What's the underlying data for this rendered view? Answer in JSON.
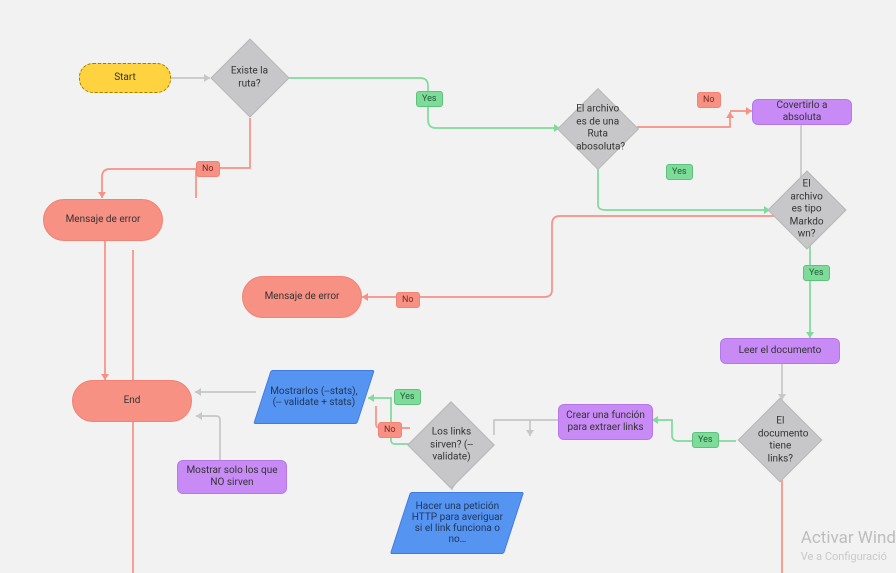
{
  "nodes": {
    "start": "Start",
    "existeRuta": "Existe la ruta?",
    "rutaAbsoluta": "El archivo es de una Ruta abosoluta?",
    "convertir": "Covertirlo a absoluta",
    "tipoMarkdown": "El archivo es tipo Markdo wn?",
    "mensajeError1": "Mensaje de error",
    "mensajeError2": "Mensaje de error",
    "leerDocumento": "Leer el documento",
    "tieneLinks": "El documento tiene links?",
    "crearFuncion": "Crear una función para extraer links",
    "linksSirven": "Los links sirven? (--validate)",
    "hacerPeticion": "Hacer una petición HTTP para averiguar si el link funciona o no…",
    "mostrarlos": "Mostrarlos (--stats),(-- validate + stats)",
    "mostrarSoloNo": "Mostrar solo los que NO sirven",
    "end": "End"
  },
  "tags": {
    "yes": "Yes",
    "no": "No"
  },
  "watermark": {
    "title": "Activar Wind",
    "subtitle": "Ve a Configuració"
  }
}
